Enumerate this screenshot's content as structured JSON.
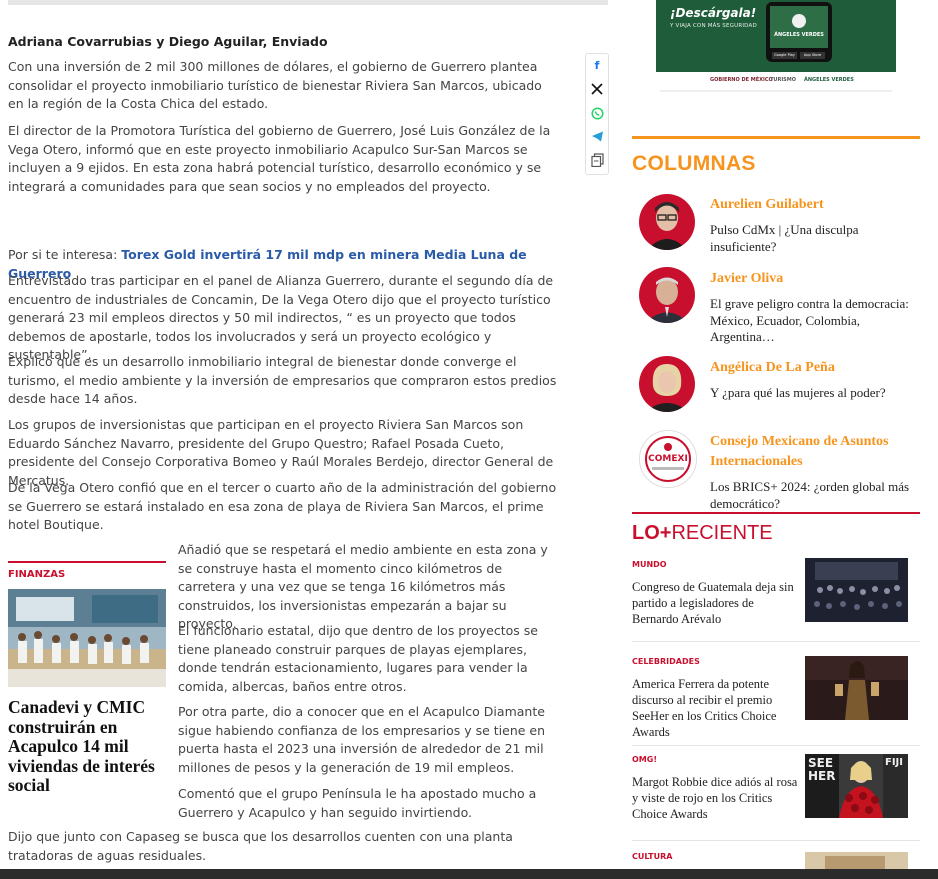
{
  "article": {
    "byline": "Adriana Covarrubias y Diego Aguilar, Enviado",
    "p1": "Con una inversión de 2 mil 300 millones de dólares, el gobierno de Guerrero plantea consolidar el proyecto inmobiliario turístico de bienestar Riviera San Marcos, ubicado en la región de la Costa Chica del estado.",
    "p2": "El director de la Promotora Turística del gobierno de Guerrero, José Luis González de la Vega Otero, informó que en este proyecto inmobiliario Acapulco Sur-San Marcos se incluyen a 9 ejidos. En esta zona habrá potencial turístico, desarrollo económico y se integrará a comunidades para que sean socios y no empleados del proyecto.",
    "interest_prefix": "Por si te interesa: ",
    "interest_link": "Torex Gold invertirá 17 mil mdp en minera Media Luna de Guerrero",
    "p3": "Entrevistado tras participar en el panel de Alianza Guerrero, durante el segundo día de encuentro de industriales de Concamin, De la Vega Otero dijo que el proyecto turístico generará 23 mil empleos directos y 50 mil indirectos, “ es un proyecto que todos debemos de apostarle, todos los involucrados y será un proyecto ecológico y sustentable”.",
    "p4": "Explicó que es un desarrollo inmobiliario integral de bienestar donde converge el turismo, el medio ambiente y la inversión de empresarios que compraron estos predios desde hace 14 años.",
    "p5": "Los grupos de inversionistas que participan en el proyecto Riviera San Marcos son Eduardo Sánchez Navarro, presidente del Grupo Questro; Rafael Posada Cueto, presidente del Consejo Corporativa Bomeo y Raúl Morales Berdejo, director General de Mercatus.",
    "p6": "De la Vega Otero confió que en el tercer o cuarto año de la administración del gobierno se Guerrero se estará instalado en esa zona de playa de Riviera San Marcos, el prime hotel Boutique.",
    "p7": "Añadió que se respetará el medio ambiente en esta zona y se construye hasta el momento cinco kilómetros de carretera y una vez que se tenga 16 kilómetros más construidos, los inversionistas empezarán a bajar su proyecto.",
    "p8": "El funcionario estatal, dijo que dentro de los proyectos se tiene planeado construir parques de playas ejemplares, donde tendrán estacionamiento, lugares para vender la comida, albercas, baños entre otros.",
    "p9": "Por otra parte, dio a conocer que en el Acapulco Diamante sigue habiendo confianza de los empresarios y se tiene en puerta hasta el 2023 una inversión de alrededor de 21 mil millones de pesos y la generación de 19 mil empleos.",
    "p10": "Comentó que el grupo Península le ha apostado mucho a Guerrero y Acapulco y han seguido invirtiendo.",
    "p11": "Dijo que junto con Capaseg se busca que los desarrollos cuenten con una planta tratadoras de aguas residuales."
  },
  "related": {
    "category": "FINANZAS",
    "title": "Canadevi y CMIC construirán en Acapulco 14 mil viviendas de interés social"
  },
  "share": {
    "icons": [
      "facebook-icon",
      "x-icon",
      "whatsapp-icon",
      "telegram-icon",
      "copy-icon"
    ],
    "facebook": "f",
    "x": "X"
  },
  "ad": {
    "headline": "¡Descárgala!",
    "tagline": "Y VIAJA CON MÁS SEGURIDAD",
    "app_name": "ÁNGELES VERDES",
    "store1": "Google Play",
    "store2": "App Store",
    "logo1": "GOBIERNO DE MÉXICO",
    "logo2": "TURISMO",
    "logo3": "ÁNGELES VERDES"
  },
  "columnas": {
    "title": "COLUMNAS",
    "items": [
      {
        "author": "Aurelien Guilabert",
        "text": "Pulso CdMx | ¿Una disculpa insuficiente?"
      },
      {
        "author": "Javier Oliva",
        "text": "El grave peligro contra la democracia: México, Ecuador, Colombia, Argentina…"
      },
      {
        "author": "Angélica De La Peña",
        "text": "Y ¿para qué las mujeres al poder?"
      },
      {
        "author": "Consejo Mexicano de Asuntos Internacionales",
        "text": "Los BRICS+ 2024: ¿orden global más democrático?"
      }
    ],
    "comexi_logo": "COMEXI"
  },
  "reciente": {
    "title_bold": "LO+",
    "title_rest": "RECIENTE",
    "items": [
      {
        "category": "MUNDO",
        "text": "Congreso de Guatemala deja sin partido a legisladores de Bernardo Arévalo"
      },
      {
        "category": "CELEBRIDADES",
        "text": "America Ferrera da potente discurso al recibir el premio SeeHer en los Critics Choice Awards"
      },
      {
        "category": "OMG!",
        "text": "Margot Robbie dice adiós al rosa y viste de rojo en los Critics Choice Awards"
      },
      {
        "category": "CULTURA",
        "text": ""
      }
    ],
    "img3_text1": "SEE",
    "img3_text2": "HER",
    "img3_text3": "FIJI"
  },
  "colors": {
    "accent_orange": "#f7941d",
    "accent_red": "#c8102e",
    "link_blue": "#2a5aa8"
  }
}
